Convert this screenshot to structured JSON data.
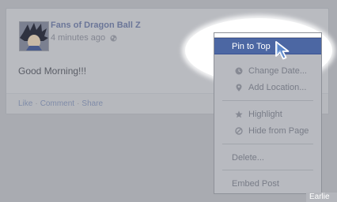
{
  "post": {
    "page_name": "Fans of Dragon Ball Z",
    "timestamp": "4 minutes ago",
    "privacy_icon": "globe-icon",
    "text": "Good Morning!!!",
    "actions": [
      {
        "label": "Like"
      },
      {
        "label": "Comment"
      },
      {
        "label": "Share"
      }
    ],
    "action_separator": "·"
  },
  "menu": {
    "items": [
      {
        "label": "Pin to Top",
        "icon": null,
        "highlighted": true
      },
      {
        "label": "Change Date...",
        "icon": "clock-icon"
      },
      {
        "label": "Add Location...",
        "icon": "location-pin-icon"
      },
      {
        "label": "Highlight",
        "icon": "star-icon"
      },
      {
        "label": "Hide from Page",
        "icon": "hide-circle-icon"
      },
      {
        "label": "Delete...",
        "icon": null
      },
      {
        "label": "Embed Post",
        "icon": null
      }
    ]
  },
  "timeline": {
    "older_label": "Earlie"
  },
  "colors": {
    "overlay_background": "#a9abb1",
    "highlight_blue": "#4c67a3",
    "link_blue": "#6b7698"
  }
}
